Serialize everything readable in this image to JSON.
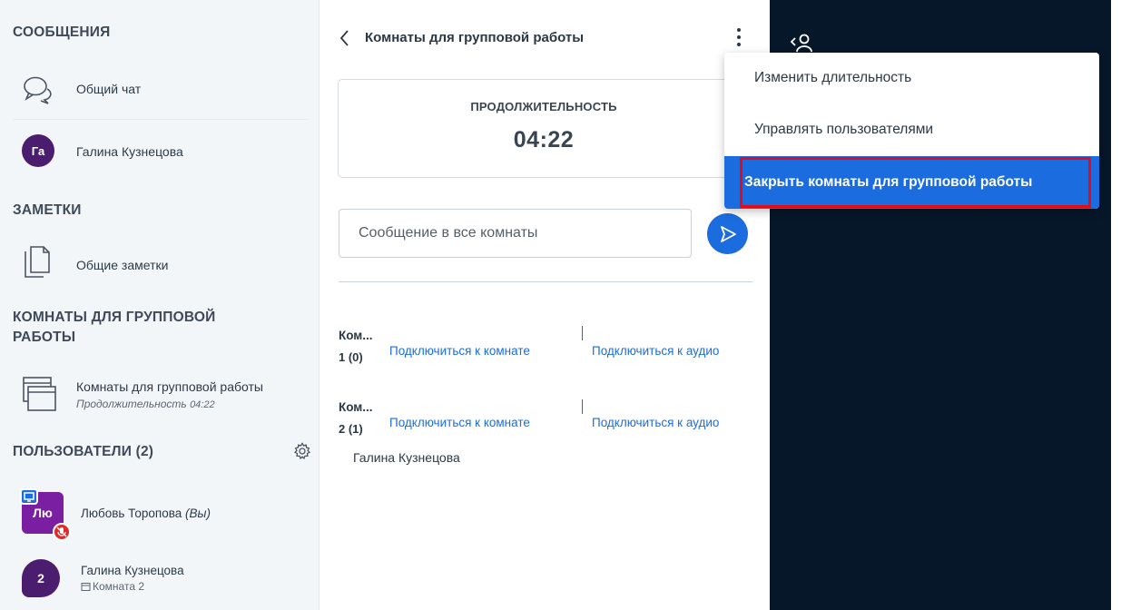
{
  "sidebar": {
    "messages": {
      "title": "СООБЩЕНИЯ",
      "items": [
        {
          "label": "Общий чат",
          "icon": "chat-bubbles-icon"
        },
        {
          "label": "Галина Кузнецова",
          "avatar": "Га",
          "avatar_color": "#4a1d6e"
        }
      ]
    },
    "notes": {
      "title": "ЗАМЕТКИ",
      "items": [
        {
          "label": "Общие заметки",
          "icon": "notes-icon"
        }
      ]
    },
    "breakout": {
      "title_line1": "КОМНАТЫ ДЛЯ ГРУППОВОЙ",
      "title_line2": "РАБОТЫ",
      "item_label": "Комнаты для групповой работы",
      "item_sub_label": "Продолжительность",
      "item_sub_value": "04:22",
      "icon": "breakout-rooms-icon"
    },
    "users": {
      "title": "ПОЛЬЗОВАТЕЛИ (2)",
      "settings_icon": "gear-icon",
      "list": [
        {
          "name": "Любовь Торопова",
          "suffix": "(Вы)",
          "avatar": "Лю",
          "avatar_color": "#7b1fa2",
          "presenter_icon": "presenter-icon",
          "muted_icon": "muted-mic-icon"
        },
        {
          "name": "Галина Кузнецова",
          "avatar": "2",
          "avatar_color": "#4a1d6e",
          "room_label": "Комната 2"
        }
      ]
    }
  },
  "breakout_panel": {
    "title": "Комнаты для групповой работы",
    "duration_label": "ПРОДОЛЖИТЕЛЬНОСТЬ",
    "duration_value": "04:22",
    "message_placeholder": "Сообщение в все комнаты",
    "rooms": [
      {
        "name_line1": "Ком...",
        "name_line2": "1 (0)",
        "join_room": "Подключиться к комнате",
        "join_audio": "Подключиться к аудио",
        "users": []
      },
      {
        "name_line1": "Ком...",
        "name_line2": "2 (1)",
        "join_room": "Подключиться к комнате",
        "join_audio": "Подключиться к аудио",
        "users": [
          "Галина Кузнецова"
        ]
      }
    ]
  },
  "options_menu": {
    "items": [
      {
        "label": "Изменить длительность"
      },
      {
        "label": "Управлять пользователями"
      },
      {
        "label": "Закрыть комнаты для групповой работы",
        "active": true,
        "highlighted": true
      }
    ]
  },
  "colors": {
    "accent": "#1b6cdf",
    "dark_background": "#06172a",
    "sidebar_background": "#f3f6f9",
    "highlight_outline": "#e30b17"
  }
}
